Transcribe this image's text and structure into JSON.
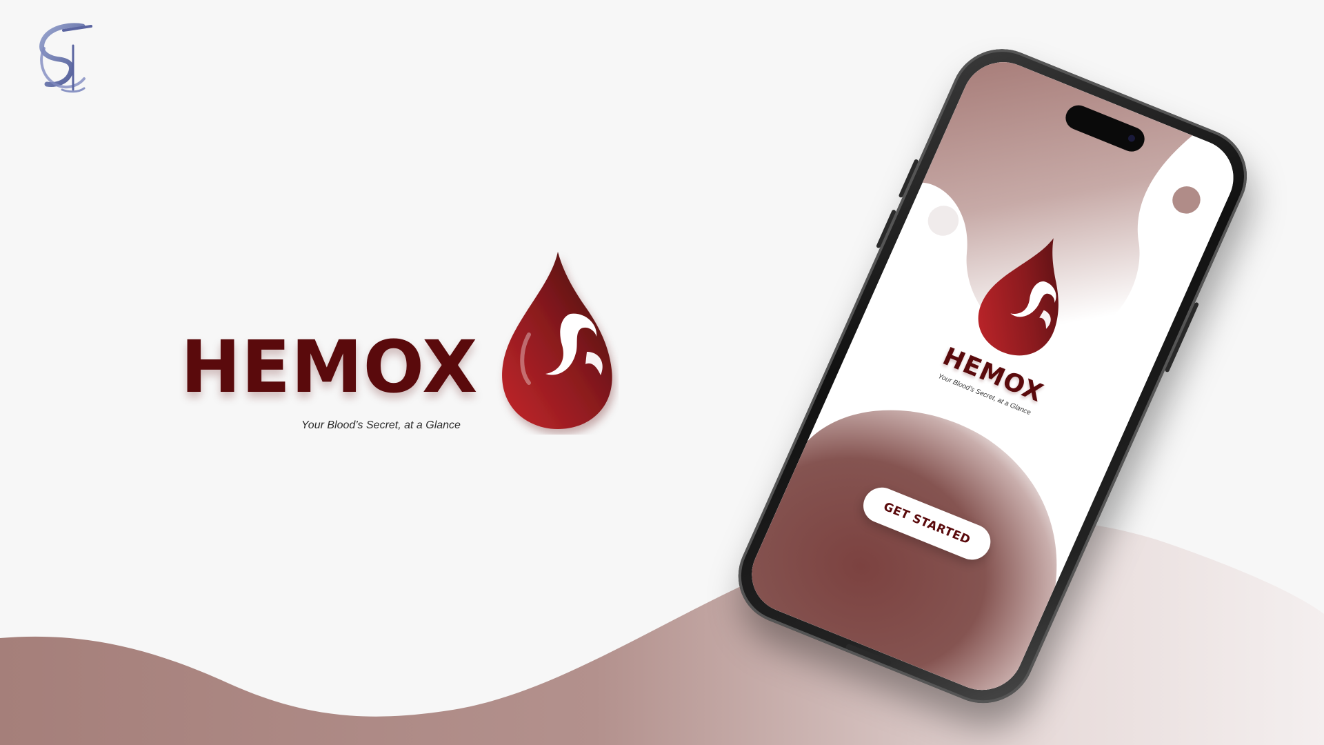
{
  "page": {
    "colors": {
      "background": "#f7f7f7",
      "brand_dark_red": "#5a0a0c",
      "brand_red": "#a3191f",
      "wave_mauve": "#a07873",
      "screen_maroon": "#7f4542"
    }
  },
  "corner_logo": {
    "icon": "institution-logo-icon"
  },
  "brand": {
    "name": "HEMOX",
    "tagline": "Your Blood’s Secret, at a Glance",
    "icon": "blood-drop-logo-icon"
  },
  "phone": {
    "app": {
      "title": "HEMOX",
      "tagline": "Your Blood’s Secret, at a Glance",
      "icon": "blood-drop-logo-icon",
      "cta_label": "GET STARTED"
    }
  }
}
